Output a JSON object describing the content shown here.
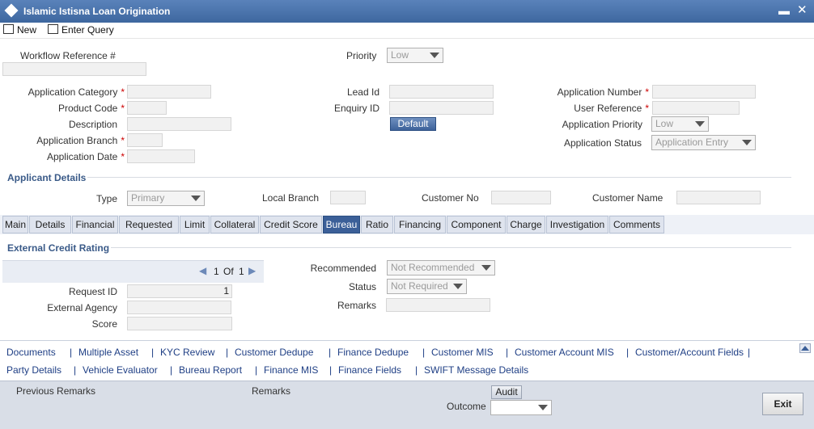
{
  "window": {
    "title": "Islamic Istisna Loan Origination"
  },
  "toolbar": {
    "new_label": "New",
    "enter_query_label": "Enter Query"
  },
  "header": {
    "workflow_ref_label": "Workflow Reference #",
    "priority_label": "Priority",
    "priority_value": "Low"
  },
  "app": {
    "category_label": "Application Category",
    "product_code_label": "Product Code",
    "description_label": "Description",
    "branch_label": "Application Branch",
    "date_label": "Application Date",
    "lead_id_label": "Lead Id",
    "enquiry_id_label": "Enquiry ID",
    "default_button": "Default",
    "number_label": "Application Number",
    "user_ref_label": "User Reference",
    "app_priority_label": "Application Priority",
    "app_priority_value": "Low",
    "status_label": "Application Status",
    "status_value": "Application Entry",
    "required_mark": "*"
  },
  "applicant": {
    "section_title": "Applicant Details",
    "type_label": "Type",
    "type_value": "Primary",
    "local_branch_label": "Local Branch",
    "customer_no_label": "Customer No",
    "customer_name_label": "Customer Name"
  },
  "tabs": [
    "Main",
    "Details",
    "Financial",
    "Requested",
    "Limit",
    "Collateral",
    "Credit Score",
    "Bureau",
    "Ratio",
    "Financing",
    "Component",
    "Charge",
    "Investigation",
    "Comments"
  ],
  "active_tab": "Bureau",
  "bureau": {
    "section_title": "External Credit Rating",
    "pager_current": "1",
    "pager_of": "Of",
    "pager_total": "1",
    "request_id_label": "Request ID",
    "request_id_value": "1",
    "external_agency_label": "External Agency",
    "score_label": "Score",
    "recommended_label": "Recommended",
    "recommended_value": "Not Recommended",
    "status_label": "Status",
    "status_value": "Not Required",
    "remarks_label": "Remarks"
  },
  "links_row1": [
    "Documents",
    "Multiple Asset",
    "KYC Review",
    "Customer Dedupe",
    "Finance Dedupe",
    "Customer MIS",
    "Customer Account MIS",
    "Customer/Account Fields"
  ],
  "links_row2": [
    "Party Details",
    "Vehicle Evaluator",
    "Bureau Report",
    "Finance MIS",
    "Finance Fields",
    "SWIFT Message Details"
  ],
  "link_separator": "|",
  "footer": {
    "previous_remarks_label": "Previous Remarks",
    "remarks_label": "Remarks",
    "audit_button": "Audit",
    "outcome_label": "Outcome",
    "exit_button": "Exit"
  }
}
